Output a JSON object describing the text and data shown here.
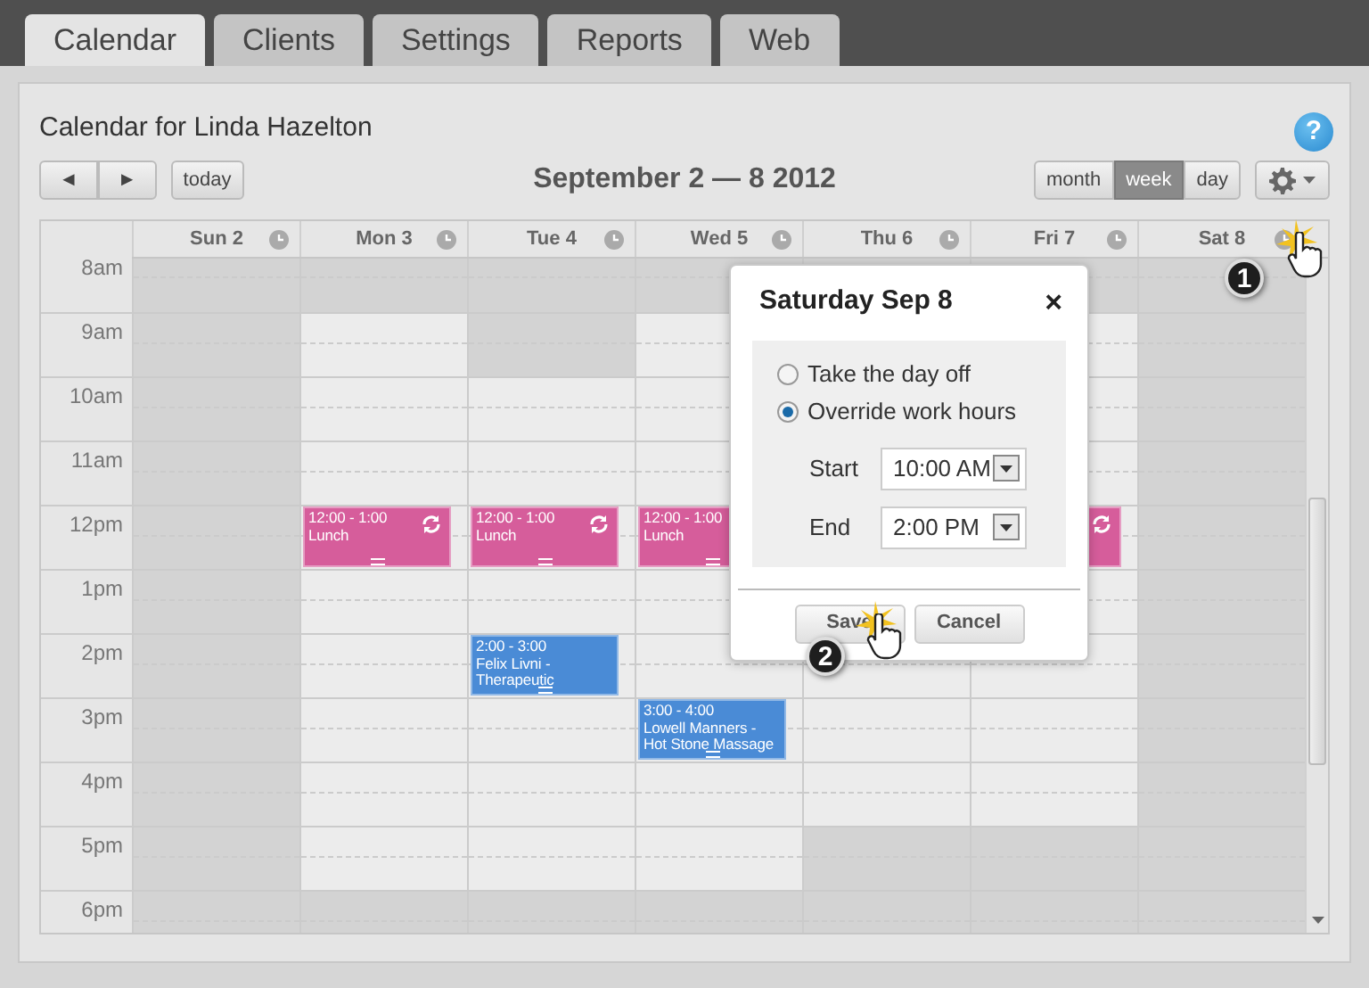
{
  "tabs": [
    {
      "label": "Calendar",
      "selected": true
    },
    {
      "label": "Clients",
      "selected": false
    },
    {
      "label": "Settings",
      "selected": false
    },
    {
      "label": "Reports",
      "selected": false
    },
    {
      "label": "Web",
      "selected": false
    }
  ],
  "calendar": {
    "title": "Calendar for Linda Hazelton",
    "help": "?",
    "nav": [
      "◄",
      "►"
    ],
    "today": "today",
    "range": "September 2 — 8 2012",
    "views": [
      {
        "label": "month",
        "selected": false
      },
      {
        "label": "week",
        "selected": true
      },
      {
        "label": "day",
        "selected": false
      }
    ],
    "days": [
      "Sun 2",
      "Mon 3",
      "Tue 4",
      "Wed 5",
      "Thu 6",
      "Fri 7",
      "Sat 8"
    ],
    "hours": [
      {
        "label": "8am",
        "cells": [
          {
            "off": true
          },
          {
            "off": true
          },
          {
            "off": true
          },
          {
            "off": true
          },
          {
            "off": true
          },
          {
            "off": true
          },
          {
            "off": true
          }
        ]
      },
      {
        "label": "9am",
        "cells": [
          {
            "off": true
          },
          {
            "off": false
          },
          {
            "off": true
          },
          {
            "off": false
          },
          {},
          {
            "off": false
          },
          {
            "off": true
          }
        ]
      },
      {
        "label": "10am",
        "cells": [
          {
            "off": true
          },
          {
            "off": false
          },
          {
            "off": false
          },
          {
            "off": false
          },
          {},
          {
            "off": false
          },
          {
            "off": true
          }
        ]
      },
      {
        "label": "11am",
        "cells": [
          {
            "off": true
          },
          {
            "off": false
          },
          {
            "off": false
          },
          {
            "off": false
          },
          {},
          {
            "off": false
          },
          {
            "off": true
          }
        ]
      },
      {
        "label": "12pm",
        "cells": [
          {
            "off": true
          },
          {
            "off": false,
            "events": [
              {
                "time": "12:00 - 1:00",
                "title": "Lunch",
                "color": "#d65d9b",
                "recurring": true,
                "handle": true
              }
            ]
          },
          {
            "off": false,
            "events": [
              {
                "time": "12:00 - 1:00",
                "title": "Lunch",
                "color": "#d65d9b",
                "recurring": true,
                "handle": true
              }
            ]
          },
          {
            "off": false,
            "events": [
              {
                "time": "12:00 - 1:00",
                "title": "Lunch",
                "color": "#d65d9b",
                "handle": true
              }
            ]
          },
          {},
          {
            "off": false,
            "events": [
              {
                "color": "#d65d9b",
                "recurring": true
              }
            ]
          },
          {
            "off": true
          }
        ]
      },
      {
        "label": "1pm",
        "cells": [
          {
            "off": true
          },
          {
            "off": false
          },
          {
            "off": false
          },
          {
            "off": false
          },
          {},
          {
            "off": false
          },
          {
            "off": true
          }
        ]
      },
      {
        "label": "2pm",
        "cells": [
          {
            "off": true
          },
          {
            "off": false
          },
          {
            "off": false,
            "events": [
              {
                "time": "2:00 - 3:00",
                "title": "Felix Livni - Therapeutic",
                "color": "#4a8bd6",
                "handle": true
              }
            ]
          },
          {
            "off": false
          },
          {
            "off": false
          },
          {
            "off": false
          },
          {
            "off": true
          }
        ]
      },
      {
        "label": "3pm",
        "cells": [
          {
            "off": true
          },
          {
            "off": false
          },
          {
            "off": false
          },
          {
            "off": false,
            "events": [
              {
                "time": "3:00 - 4:00",
                "title": "Lowell Manners - Hot Stone Massage",
                "color": "#4a8bd6",
                "handle": true
              }
            ]
          },
          {
            "off": false
          },
          {
            "off": false
          },
          {
            "off": true
          }
        ]
      },
      {
        "label": "4pm",
        "cells": [
          {
            "off": true
          },
          {
            "off": false
          },
          {
            "off": false
          },
          {
            "off": false
          },
          {
            "off": false
          },
          {
            "off": false
          },
          {
            "off": true
          }
        ]
      },
      {
        "label": "5pm",
        "cells": [
          {
            "off": true
          },
          {
            "off": false
          },
          {
            "off": false
          },
          {
            "off": false
          },
          {
            "off": true
          },
          {
            "off": true
          },
          {
            "off": true
          }
        ]
      },
      {
        "label": "6pm",
        "cells": [
          {
            "off": true
          },
          {
            "off": true
          },
          {
            "off": true
          },
          {
            "off": true
          },
          {
            "off": true
          },
          {
            "off": true
          },
          {
            "off": true
          }
        ]
      }
    ]
  },
  "dialog": {
    "title": "Saturday Sep 8",
    "close": "×",
    "options": [
      {
        "label": "Take the day off",
        "selected": false
      },
      {
        "label": "Override work hours",
        "selected": true
      }
    ],
    "fields": [
      {
        "label": "Start",
        "value": "10:00 AM"
      },
      {
        "label": "End",
        "value": "2:00 PM"
      }
    ],
    "buttons": [
      "Save",
      "Cancel"
    ]
  },
  "callouts": [
    "1",
    "2"
  ]
}
